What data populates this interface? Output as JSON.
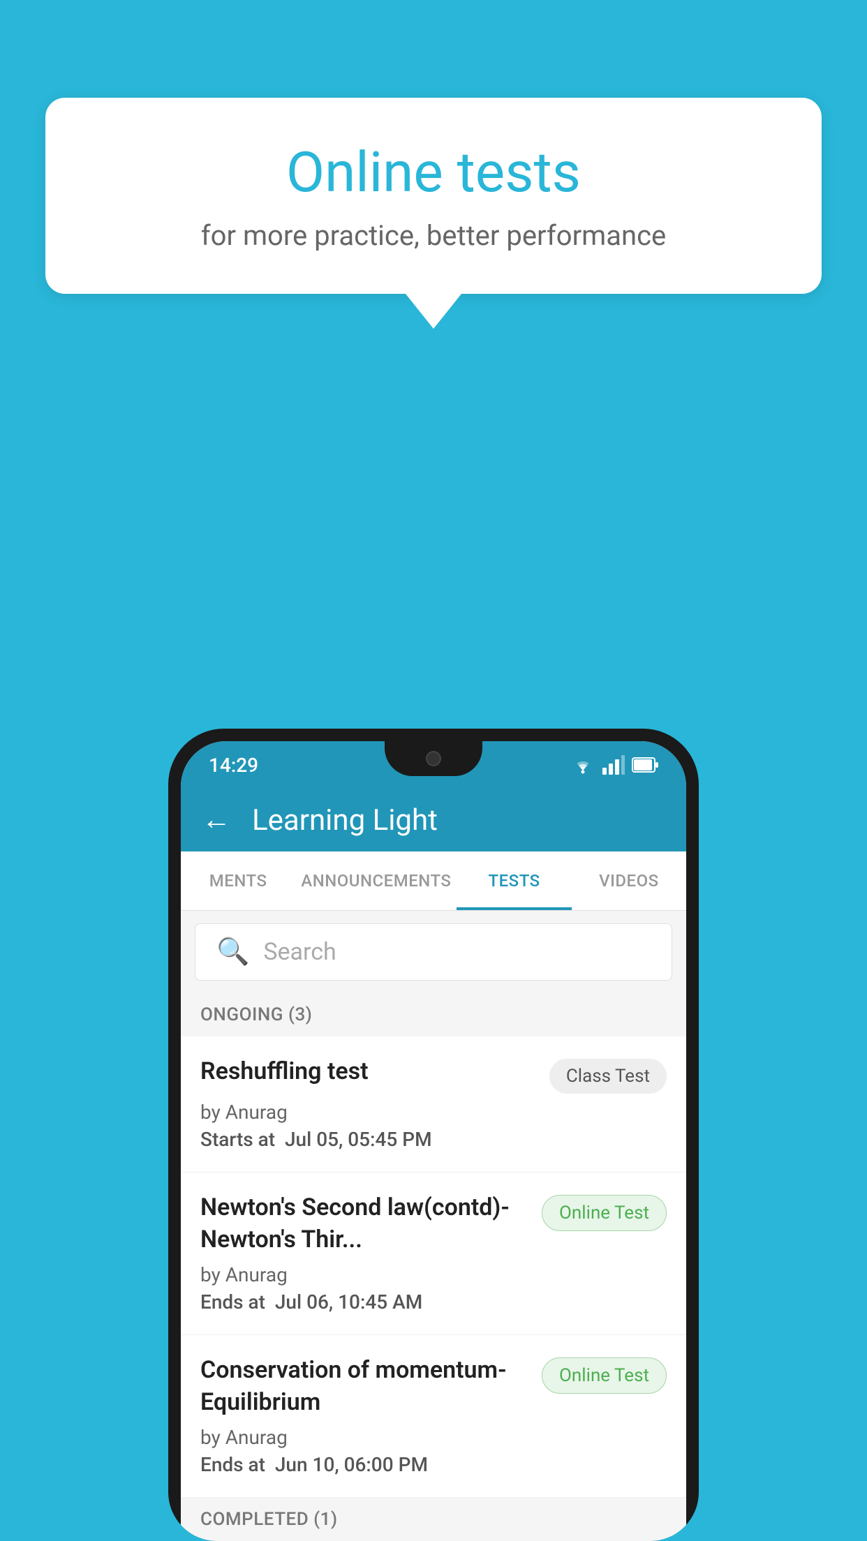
{
  "background_color": "#29b6d8",
  "speech_bubble": {
    "title": "Online tests",
    "subtitle": "for more practice, better performance"
  },
  "phone": {
    "status_bar": {
      "time": "14:29"
    },
    "header": {
      "title": "Learning Light",
      "back_label": "←"
    },
    "tabs": [
      {
        "label": "MENTS",
        "active": false
      },
      {
        "label": "ANNOUNCEMENTS",
        "active": false
      },
      {
        "label": "TESTS",
        "active": true
      },
      {
        "label": "VIDEOS",
        "active": false
      }
    ],
    "search": {
      "placeholder": "Search"
    },
    "ongoing_section": {
      "label": "ONGOING (3)"
    },
    "tests": [
      {
        "title": "Reshuffling test",
        "badge": "Class Test",
        "badge_type": "class",
        "author": "by Anurag",
        "date_label": "Starts at",
        "date": "Jul 05, 05:45 PM"
      },
      {
        "title": "Newton's Second law(contd)-Newton's Thir...",
        "badge": "Online Test",
        "badge_type": "online",
        "author": "by Anurag",
        "date_label": "Ends at",
        "date": "Jul 06, 10:45 AM"
      },
      {
        "title": "Conservation of momentum-Equilibrium",
        "badge": "Online Test",
        "badge_type": "online",
        "author": "by Anurag",
        "date_label": "Ends at",
        "date": "Jun 10, 06:00 PM"
      }
    ],
    "completed_section": {
      "label": "COMPLETED (1)"
    }
  }
}
